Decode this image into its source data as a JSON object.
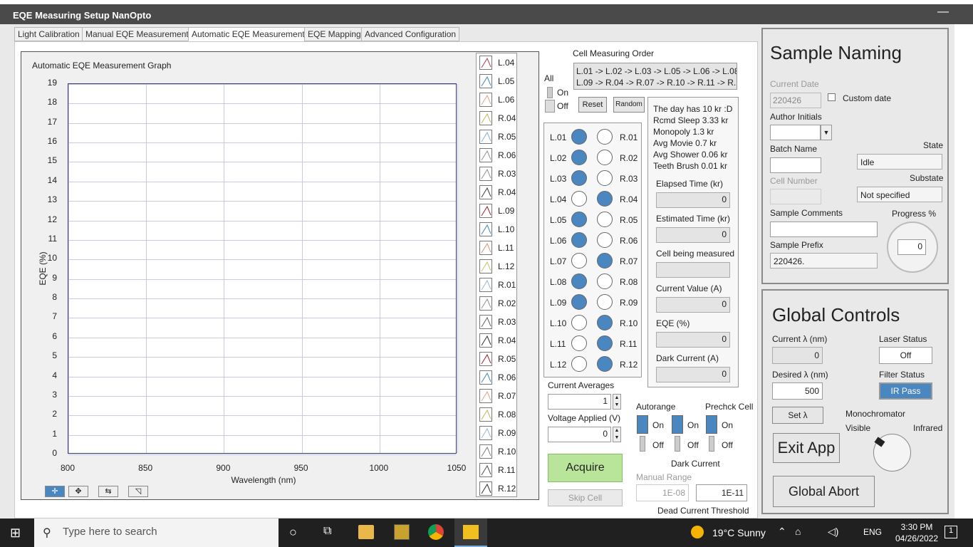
{
  "window": {
    "title": "EQE Measuring Setup NanOpto",
    "minimize": "—"
  },
  "tabs": [
    "Light Calibration",
    "Manual EQE Measurement",
    "Automatic EQE Measurement",
    "EQE Mapping",
    "Advanced Configuration"
  ],
  "graph": {
    "title": "Automatic EQE Measurement Graph",
    "xlabel": "Wavelength (nm)",
    "ylabel": "EQE (%)",
    "yticks": [
      "19",
      "18",
      "17",
      "16",
      "15",
      "14",
      "13",
      "12",
      "11",
      "10",
      "9",
      "8",
      "7",
      "6",
      "5",
      "4",
      "3",
      "2",
      "1",
      "0"
    ],
    "xticks": [
      "800",
      "850",
      "900",
      "950",
      "1000",
      "1050"
    ]
  },
  "chart_data": {
    "type": "line",
    "title": "Automatic EQE Measurement Graph",
    "xlabel": "Wavelength (nm)",
    "ylabel": "EQE (%)",
    "xlim": [
      800,
      1050
    ],
    "ylim": [
      0,
      19
    ],
    "grid": true,
    "legend_position": "right",
    "series": [
      {
        "name": "L.04",
        "color": "#b04050",
        "values": []
      },
      {
        "name": "L.05",
        "color": "#3a8ac8",
        "values": []
      },
      {
        "name": "L.06",
        "color": "#e0a080",
        "values": []
      },
      {
        "name": "R.04",
        "color": "#c8b060",
        "values": []
      },
      {
        "name": "R.05",
        "color": "#80b0e0",
        "values": []
      },
      {
        "name": "R.06",
        "color": "#909090",
        "values": []
      },
      {
        "name": "R.03",
        "color": "#909090",
        "values": []
      },
      {
        "name": "R.04",
        "color": "#404040",
        "values": []
      },
      {
        "name": "L.09",
        "color": "#a02030",
        "values": []
      },
      {
        "name": "L.10",
        "color": "#3a8ac8",
        "values": []
      },
      {
        "name": "L.11",
        "color": "#e09070",
        "values": []
      },
      {
        "name": "L.12",
        "color": "#c8c070",
        "values": []
      },
      {
        "name": "R.01",
        "color": "#90b8e0",
        "values": []
      },
      {
        "name": "R.02",
        "color": "#909090",
        "values": []
      },
      {
        "name": "R.03",
        "color": "#606060",
        "values": []
      },
      {
        "name": "R.04",
        "color": "#303030",
        "values": []
      },
      {
        "name": "R.05",
        "color": "#a02030",
        "values": []
      },
      {
        "name": "R.06",
        "color": "#3a8ac8",
        "values": []
      },
      {
        "name": "R.07",
        "color": "#e0a080",
        "values": []
      },
      {
        "name": "R.08",
        "color": "#c8b060",
        "values": []
      },
      {
        "name": "R.09",
        "color": "#90b8e0",
        "values": []
      },
      {
        "name": "R.10",
        "color": "#808080",
        "values": []
      },
      {
        "name": "R.11",
        "color": "#505050",
        "values": []
      },
      {
        "name": "R.12",
        "color": "#303030",
        "values": []
      }
    ]
  },
  "order": {
    "label": "Cell Measuring Order",
    "line1": "L.01 -> L.02 -> L.03 -> L.05 -> L.06 -> L.08",
    "line2": "L.09 -> R.04 -> R.07 -> R.10 -> R.11 -> R.1"
  },
  "all": {
    "label": "All",
    "on": "On",
    "off": "Off",
    "reset": "Reset",
    "random": "Random"
  },
  "cells": [
    {
      "l": "L.01",
      "lon": true,
      "r": "R.01",
      "ron": false
    },
    {
      "l": "L.02",
      "lon": true,
      "r": "R.02",
      "ron": false
    },
    {
      "l": "L.03",
      "lon": true,
      "r": "R.03",
      "ron": false
    },
    {
      "l": "L.04",
      "lon": false,
      "r": "R.04",
      "ron": true
    },
    {
      "l": "L.05",
      "lon": true,
      "r": "R.05",
      "ron": false
    },
    {
      "l": "L.06",
      "lon": true,
      "r": "R.06",
      "ron": false
    },
    {
      "l": "L.07",
      "lon": false,
      "r": "R.07",
      "ron": true
    },
    {
      "l": "L.08",
      "lon": true,
      "r": "R.08",
      "ron": false
    },
    {
      "l": "L.09",
      "lon": true,
      "r": "R.09",
      "ron": false
    },
    {
      "l": "L.10",
      "lon": false,
      "r": "R.10",
      "ron": true
    },
    {
      "l": "L.11",
      "lon": false,
      "r": "R.11",
      "ron": true
    },
    {
      "l": "L.12",
      "lon": false,
      "r": "R.12",
      "ron": true
    }
  ],
  "info": {
    "l1": "The day has 10 kr :D",
    "l2": "Rcmd Sleep 3.33 kr",
    "l3": "Monopoly 1.3 kr",
    "l4": "Avg Movie 0.7 kr",
    "l5": "Avg Shower 0.06 kr",
    "l6": "Teeth Brush 0.01 kr",
    "elapsed_label": "Elapsed Time (kr)",
    "elapsed": "0",
    "estimated_label": "Estimated Time (kr)",
    "estimated": "0",
    "cell_label": "Cell being measured",
    "cell": "",
    "current_label": "Current Value (A)",
    "current": "0",
    "eqe_label": "EQE (%)",
    "eqe": "0",
    "dark_label": "Dark Current (A)",
    "dark": "0"
  },
  "controls": {
    "avg_label": "Current Averages",
    "avg": "1",
    "volt_label": "Voltage Applied (V)",
    "volt": "0",
    "acquire": "Acquire",
    "skip": "Skip Cell",
    "autorange": "Autorange",
    "prechck": "Prechck Cell",
    "on": "On",
    "off": "Off",
    "dark_current": "Dark Current",
    "manual_range": "Manual Range",
    "manual_val": "1E-08",
    "threshold_val": "1E-11",
    "threshold_label": "Dead Current Threshold"
  },
  "naming": {
    "title": "Sample Naming",
    "date_label": "Current Date",
    "date": "220426",
    "custom": "Custom date",
    "author_label": "Author Initials",
    "author": "",
    "batch_label": "Batch Name",
    "batch": "",
    "state_label": "State",
    "state": "Idle",
    "cellnum_label": "Cell Number",
    "cellnum": "",
    "substate_label": "Substate",
    "substate": "Not specified",
    "comments_label": "Sample Comments",
    "comments": "",
    "progress_label": "Progress %",
    "progress": "0",
    "prefix_label": "Sample Prefix",
    "prefix": "220426."
  },
  "global": {
    "title": "Global Controls",
    "cur_label": "Current λ (nm)",
    "cur": "0",
    "laser_label": "Laser Status",
    "laser": "Off",
    "des_label": "Desired λ (nm)",
    "des": "500",
    "filter_label": "Filter Status",
    "filter": "IR Pass",
    "set": "Set  λ",
    "mono": "Monochromator",
    "visible": "Visible",
    "infrared": "Infrared",
    "exit": "Exit App",
    "abort": "Global Abort"
  },
  "taskbar": {
    "search": "Type here to search",
    "temp": "19°C  Sunny",
    "lang": "ENG",
    "time": "3:30 PM",
    "date": "04/26/2022"
  }
}
